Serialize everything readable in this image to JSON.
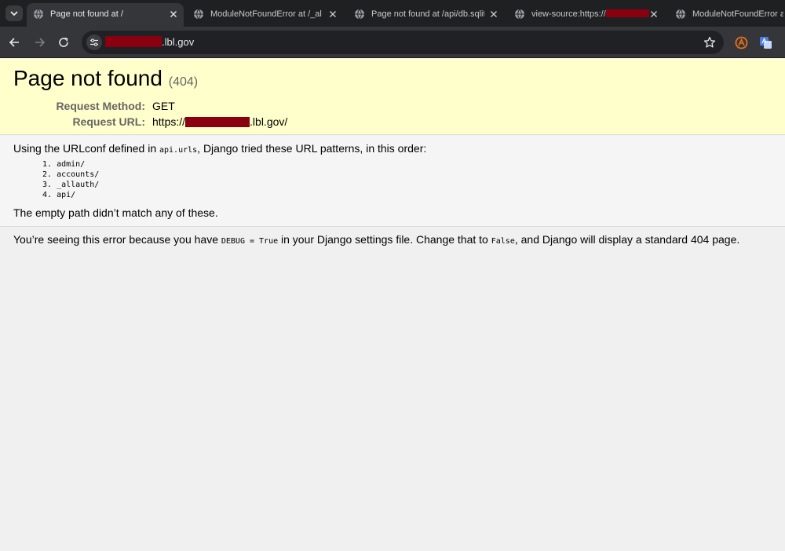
{
  "browser": {
    "tabs": [
      {
        "title": "Page not found at /",
        "active": true
      },
      {
        "title": "ModuleNotFoundError at /_allau",
        "active": false
      },
      {
        "title": "Page not found at /api/db.sqlite",
        "active": false
      },
      {
        "title": "view-source:https://",
        "active": false
      },
      {
        "title": "ModuleNotFoundError at /",
        "active": false
      }
    ],
    "address": {
      "url_suffix": ".lbl.gov"
    }
  },
  "error": {
    "title": "Page not found",
    "status_code": "(404)",
    "request_method_label": "Request Method:",
    "request_method": "GET",
    "request_url_label": "Request URL:",
    "request_url_prefix": "https://",
    "request_url_suffix": ".lbl.gov/"
  },
  "info": {
    "intro_before": "Using the URLconf defined in ",
    "urlconf_module": "api.urls",
    "intro_after": ", Django tried these URL patterns, in this order:",
    "patterns": [
      "admin/",
      "accounts/",
      "_allauth/",
      "api/"
    ],
    "no_match": "The empty path didn’t match any of these."
  },
  "explanation": {
    "part1": "You’re seeing this error because you have ",
    "debug_setting": "DEBUG = True",
    "part2": " in your Django settings file. Change that to ",
    "false_value": "False",
    "part3": ", and Django will display a standard 404 page."
  },
  "colors": {
    "summary_bg": "#ffffcc",
    "redaction": "#8a0010",
    "chrome_dark": "#1f2022",
    "toolbar": "#35363a"
  }
}
